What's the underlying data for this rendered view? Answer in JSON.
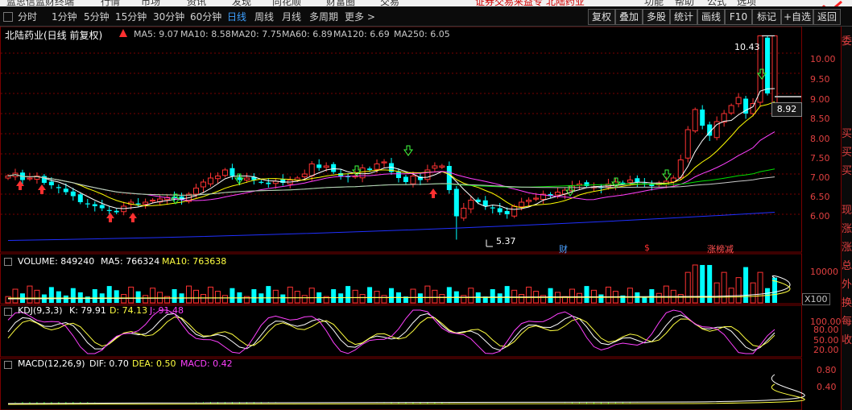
{
  "menubar": {
    "items": [
      "蓝思信蓝财终端",
      "行情",
      "市场",
      "资讯",
      "发现",
      "同花顺",
      "财富圈",
      "交易",
      "功能",
      "帮助",
      "公式",
      "选项"
    ],
    "promo": "证券交易来益专 北陆药业"
  },
  "toolbar": {
    "periods": [
      "分时",
      "1分钟",
      "5分钟",
      "15分钟",
      "30分钟",
      "60分钟",
      "日线",
      "周线",
      "月线",
      "多周期",
      "更多 >"
    ],
    "active_period": "日线",
    "right_buttons": [
      "复权",
      "叠加",
      "多股",
      "统计",
      "画线",
      "F10",
      "标记",
      "+自选",
      "返回"
    ]
  },
  "main_chart": {
    "title": "北陆药业(日线 前复权)",
    "ma": [
      {
        "label": "MA5: 9.07",
        "color": "#ffffff"
      },
      {
        "label": "MA10: 8.58",
        "color": "#ffff00"
      },
      {
        "label": "MA20: 7.75",
        "color": "#ff40ff"
      },
      {
        "label": "MA60: 6.89",
        "color": "#00e000"
      },
      {
        "label": "MA120: 6.69",
        "color": "#c8c8c8"
      },
      {
        "label": "MA250: 6.05",
        "color": "#2030ff"
      }
    ],
    "y_ticks": [
      "10.00",
      "9.50",
      "9.00",
      "8.50",
      "8.00",
      "7.50",
      "7.00",
      "6.50",
      "6.00"
    ],
    "high_label": "10.43",
    "low_label": "5.37",
    "current_price": "8.92",
    "events": [
      {
        "label": "财",
        "color": "#4aa0ff"
      },
      {
        "label": "$",
        "color": "#ff3030"
      },
      {
        "label": "涨榜减",
        "color": "#ff5050"
      }
    ]
  },
  "volume": {
    "title": "VOLUME: 849240",
    "ma5": "MA5: 766324",
    "ma10": "MA10: 763638",
    "y_tick": "10000",
    "unit": "X100"
  },
  "kdj": {
    "title": "KDJ(9,3,3)",
    "k": "K: 79.91",
    "d": "D: 74.13",
    "j": "J: 91.48",
    "y_ticks": [
      "100.00",
      "80.00",
      "50.00",
      "20.00"
    ]
  },
  "macd": {
    "title": "MACD(12,26,9)",
    "dif": "DIF: 0.70",
    "dea": "DEA: 0.50",
    "macd": "MACD: 0.42",
    "y_ticks": [
      "0.80",
      "0.40"
    ]
  },
  "right_panel": {
    "chars": [
      "委",
      "买",
      "买",
      "买",
      "现",
      "涨",
      "涨",
      "总",
      "外",
      "换",
      "每",
      "收"
    ]
  },
  "colors": {
    "up": "#ff3232",
    "down": "#00ffff",
    "bg": "#000000",
    "grid": "#7a0000",
    "active": "#3ea0ff"
  },
  "chart_data": {
    "type": "candlestick",
    "price_range": [
      5.3,
      10.5
    ],
    "closes": [
      6.95,
      7.02,
      6.85,
      6.9,
      6.95,
      6.78,
      6.72,
      6.65,
      6.55,
      6.45,
      6.3,
      6.25,
      6.2,
      6.15,
      6.1,
      6.05,
      6.2,
      6.3,
      6.25,
      6.3,
      6.35,
      6.38,
      6.42,
      6.4,
      6.35,
      6.5,
      6.65,
      6.8,
      6.9,
      6.95,
      7.1,
      6.95,
      6.85,
      6.9,
      6.85,
      6.8,
      6.75,
      6.82,
      6.78,
      6.85,
      6.9,
      7.0,
      7.25,
      7.15,
      7.2,
      7.05,
      6.95,
      6.92,
      6.95,
      7.15,
      7.1,
      7.25,
      7.3,
      7.05,
      6.9,
      6.8,
      6.95,
      6.85,
      7.1,
      7.2,
      7.2,
      6.6,
      5.95,
      6.15,
      6.35,
      6.3,
      6.2,
      6.15,
      6.05,
      6.0,
      6.2,
      6.3,
      6.35,
      6.4,
      6.5,
      6.45,
      6.55,
      6.6,
      6.7,
      6.75,
      6.7,
      6.68,
      6.65,
      6.75,
      6.8,
      6.78,
      6.85,
      6.8,
      6.75,
      6.7,
      6.78,
      6.82,
      6.9,
      7.35,
      8.1,
      8.6,
      8.2,
      7.95,
      8.3,
      8.5,
      8.7,
      8.9,
      8.5,
      8.75,
      10.43,
      9.0,
      8.92
    ],
    "ma_values": {
      "MA5": 9.07,
      "MA10": 8.58,
      "MA20": 7.75,
      "MA60": 6.89,
      "MA120": 6.69,
      "MA250": 6.05
    }
  }
}
